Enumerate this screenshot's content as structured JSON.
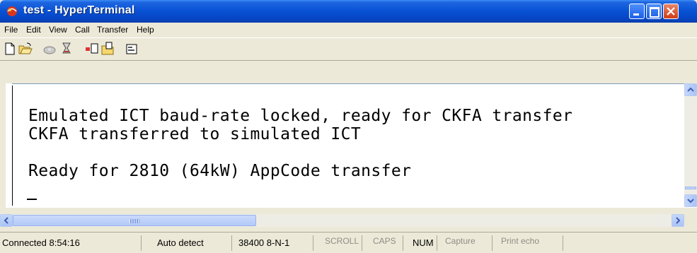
{
  "window": {
    "title": "test - HyperTerminal"
  },
  "menu": [
    "File",
    "Edit",
    "View",
    "Call",
    "Transfer",
    "Help"
  ],
  "toolbar": {
    "buttons": [
      "new-connection-icon",
      "open-icon",
      "call-icon",
      "disconnect-icon",
      "send-icon",
      "receive-icon",
      "properties-icon"
    ]
  },
  "terminal": {
    "lines": [
      "Emulated ICT baud-rate locked, ready for CKFA transfer",
      "CKFA transferred to simulated ICT",
      "",
      "Ready for 2810 (64kW) AppCode transfer"
    ]
  },
  "status": {
    "connection": "Connected 8:54:16",
    "detect": "Auto detect",
    "port_settings": "38400 8-N-1",
    "scroll": "SCROLL",
    "caps": "CAPS",
    "num": "NUM",
    "capture": "Capture",
    "print_echo": "Print echo"
  },
  "colors": {
    "titlebar": "#0a54d6",
    "chrome": "#ece9d8"
  }
}
